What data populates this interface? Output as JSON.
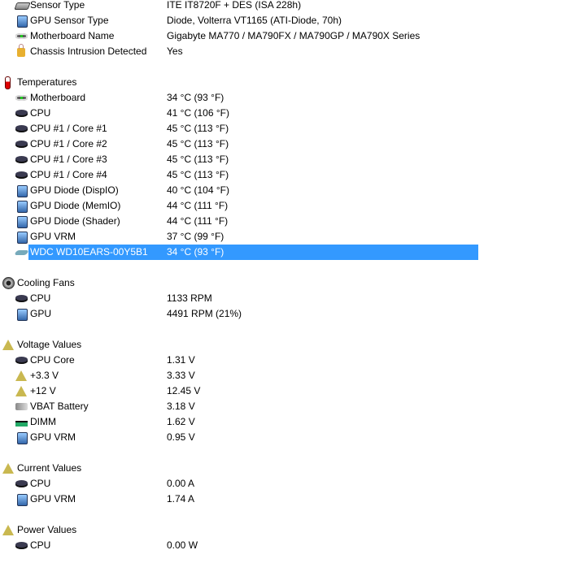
{
  "colors": {
    "selection": "#3399ff"
  },
  "rows": [
    {
      "type": "item",
      "icon": "chip",
      "label": "Sensor Type",
      "value": "ITE IT8720F + DES  (ISA 228h)"
    },
    {
      "type": "item",
      "icon": "gpu",
      "label": "GPU Sensor Type",
      "value": "Diode, Volterra VT1165  (ATI-Diode, 70h)"
    },
    {
      "type": "item",
      "icon": "mb",
      "label": "Motherboard Name",
      "value": "Gigabyte MA770 / MA790FX / MA790GP / MA790X Series"
    },
    {
      "type": "item",
      "icon": "lock",
      "label": "Chassis Intrusion Detected",
      "value": "Yes"
    },
    {
      "type": "blank"
    },
    {
      "type": "group",
      "icon": "thermo",
      "label": "Temperatures"
    },
    {
      "type": "item",
      "icon": "mb",
      "label": "Motherboard",
      "value": "34 °C  (93 °F)"
    },
    {
      "type": "item",
      "icon": "cpu",
      "label": "CPU",
      "value": "41 °C  (106 °F)"
    },
    {
      "type": "item",
      "icon": "cpu",
      "label": "CPU #1 / Core #1",
      "value": "45 °C  (113 °F)"
    },
    {
      "type": "item",
      "icon": "cpu",
      "label": "CPU #1 / Core #2",
      "value": "45 °C  (113 °F)"
    },
    {
      "type": "item",
      "icon": "cpu",
      "label": "CPU #1 / Core #3",
      "value": "45 °C  (113 °F)"
    },
    {
      "type": "item",
      "icon": "cpu",
      "label": "CPU #1 / Core #4",
      "value": "45 °C  (113 °F)"
    },
    {
      "type": "item",
      "icon": "gpu",
      "label": "GPU Diode (DispIO)",
      "value": "40 °C  (104 °F)"
    },
    {
      "type": "item",
      "icon": "gpu",
      "label": "GPU Diode (MemIO)",
      "value": "44 °C  (111 °F)"
    },
    {
      "type": "item",
      "icon": "gpu",
      "label": "GPU Diode (Shader)",
      "value": "44 °C  (111 °F)"
    },
    {
      "type": "item",
      "icon": "gpu",
      "label": "GPU VRM",
      "value": "37 °C  (99 °F)"
    },
    {
      "type": "item",
      "icon": "hdd",
      "label": "WDC WD10EARS-00Y5B1",
      "value": "34 °C  (93 °F)",
      "selected": true
    },
    {
      "type": "blank"
    },
    {
      "type": "group",
      "icon": "fan",
      "label": "Cooling Fans"
    },
    {
      "type": "item",
      "icon": "cpu",
      "label": "CPU",
      "value": "1133 RPM"
    },
    {
      "type": "item",
      "icon": "gpu",
      "label": "GPU",
      "value": "4491 RPM  (21%)"
    },
    {
      "type": "blank"
    },
    {
      "type": "group",
      "icon": "volt",
      "label": "Voltage Values"
    },
    {
      "type": "item",
      "icon": "cpu",
      "label": "CPU Core",
      "value": "1.31 V"
    },
    {
      "type": "item",
      "icon": "volt",
      "label": "+3.3 V",
      "value": "3.33 V"
    },
    {
      "type": "item",
      "icon": "volt",
      "label": "+12 V",
      "value": "12.45 V"
    },
    {
      "type": "item",
      "icon": "battery",
      "label": "VBAT Battery",
      "value": "3.18 V"
    },
    {
      "type": "item",
      "icon": "dimm",
      "label": "DIMM",
      "value": "1.62 V"
    },
    {
      "type": "item",
      "icon": "gpu",
      "label": "GPU VRM",
      "value": "0.95 V"
    },
    {
      "type": "blank"
    },
    {
      "type": "group",
      "icon": "volt",
      "label": "Current Values"
    },
    {
      "type": "item",
      "icon": "cpu",
      "label": "CPU",
      "value": "0.00 A"
    },
    {
      "type": "item",
      "icon": "gpu",
      "label": "GPU VRM",
      "value": "1.74 A"
    },
    {
      "type": "blank"
    },
    {
      "type": "group",
      "icon": "volt",
      "label": "Power Values"
    },
    {
      "type": "item",
      "icon": "cpu",
      "label": "CPU",
      "value": "0.00 W"
    }
  ]
}
